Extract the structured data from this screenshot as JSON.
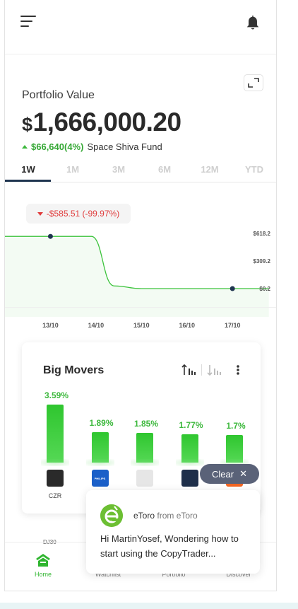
{
  "header": {
    "menu_icon": "hamburger-icon",
    "notification_icon": "bell-icon"
  },
  "portfolio": {
    "label": "Portfolio Value",
    "currency": "$",
    "value": "1,666,000.20",
    "gain": "$66,640(4%)",
    "fund_name": "Space Shiva Fund",
    "expand_icon": "expand-icon"
  },
  "time_tabs": [
    "1W",
    "1M",
    "3M",
    "6M",
    "12M",
    "YTD"
  ],
  "active_tab": "1W",
  "chart_data": {
    "type": "line",
    "badge": "-$585.51 (-99.97%)",
    "x_ticks": [
      "13/10",
      "14/10",
      "15/10",
      "16/10",
      "17/10"
    ],
    "y_ticks": [
      "$618.2",
      "$309.2",
      "$0.2"
    ],
    "ylim": [
      0.2,
      618.2
    ],
    "series": [
      {
        "x": [
          12.0,
          13.0,
          13.9,
          14.4,
          15.0,
          16.0,
          17.0,
          17.8
        ],
        "y": [
          585,
          585,
          585,
          30,
          0.2,
          0.2,
          0.2,
          0.2
        ]
      }
    ],
    "marker_points": [
      {
        "x": 13.0,
        "y": 585
      },
      {
        "x": 17.0,
        "y": 0.2
      }
    ],
    "line_color": "#3cc33c"
  },
  "movers": {
    "title": "Big Movers",
    "items": [
      {
        "pct": "3.59%",
        "value": 3.59,
        "ticker": "CZR",
        "logo_color": "#2a2a2a"
      },
      {
        "pct": "1.89%",
        "value": 1.89,
        "ticker": "P",
        "logo_color": "#1a5fc8",
        "logo_text": "PHILIPS"
      },
      {
        "pct": "1.85%",
        "value": 1.85,
        "ticker": "",
        "logo_color": "#e6e6e6"
      },
      {
        "pct": "1.77%",
        "value": 1.77,
        "ticker": "",
        "logo_color": "#1e2f4a"
      },
      {
        "pct": "1.7%",
        "value": 1.7,
        "ticker": "",
        "logo_color": "#f26522"
      }
    ]
  },
  "clear_button": {
    "label": "Clear",
    "close": "✕"
  },
  "chat": {
    "sender": "eToro",
    "from_text": "from eToro",
    "message": "Hi MartinYosef, Wondering how to start using the CopyTrader..."
  },
  "bottom_ticker": "DJ30",
  "nav": [
    {
      "label": "Home",
      "icon": "home-icon",
      "active": true
    },
    {
      "label": "Watchlist",
      "icon": "watchlist-icon",
      "active": false
    },
    {
      "label": "Portfolio",
      "icon": "portfolio-icon",
      "active": false
    },
    {
      "label": "Discover",
      "icon": "discover-icon",
      "active": false
    }
  ],
  "colors": {
    "gain": "#35a835",
    "loss": "#e03a3a",
    "accent": "#1f3550"
  }
}
